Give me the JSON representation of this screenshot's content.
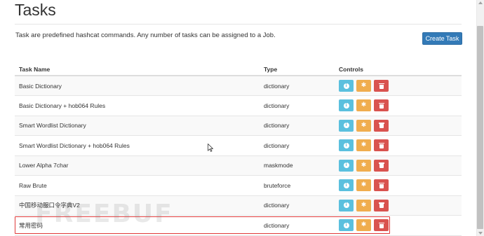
{
  "page": {
    "title": "Tasks",
    "description": "Task are predefined hashcat commands. Any number of tasks can be assigned to a Job.",
    "create_button": "Create Task"
  },
  "table": {
    "headers": {
      "name": "Task Name",
      "type": "Type",
      "controls": "Controls"
    },
    "rows": [
      {
        "name": "Basic Dictionary",
        "type": "dictionary"
      },
      {
        "name": "Basic Dictionary + hob064 Rules",
        "type": "dictionary"
      },
      {
        "name": "Smart Wordlist Dictionary",
        "type": "dictionary"
      },
      {
        "name": "Smart Wordlist Dictionary + hob064 Rules",
        "type": "dictionary"
      },
      {
        "name": "Lower Alpha 7char",
        "type": "maskmode"
      },
      {
        "name": "Raw Brute",
        "type": "bruteforce"
      },
      {
        "name": "中国移动服口令字典V2",
        "type": "dictionary"
      },
      {
        "name": "常用密码",
        "type": "dictionary"
      }
    ]
  },
  "controls": {
    "info_icon": "info-icon",
    "edit_icon": "gear-icon",
    "delete_icon": "trash-icon"
  },
  "watermark": "FREEBUF",
  "colors": {
    "primary": "#337ab7",
    "info": "#5bc0de",
    "warning": "#f0ad4e",
    "danger": "#d9534f",
    "highlight": "#e03a3a"
  }
}
